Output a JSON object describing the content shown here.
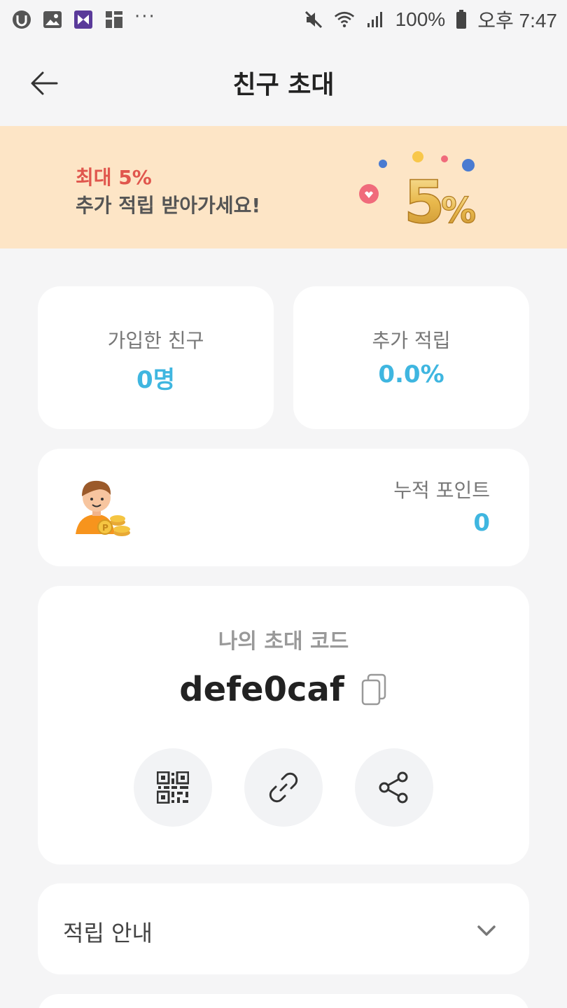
{
  "status_bar": {
    "battery": "100%",
    "time": "오후 7:47",
    "icons": [
      "u-plus-app-icon",
      "gallery-icon",
      "media-app-icon",
      "app-grid-icon",
      "more-dots-icon",
      "mute-icon",
      "wifi-icon",
      "signal-icon",
      "battery-icon"
    ]
  },
  "header": {
    "title": "친구 초대"
  },
  "banner": {
    "line1": "최대 5%",
    "line2": "추가 적립 받아가세요!"
  },
  "stats": {
    "joined_label": "가입한 친구",
    "joined_value": "0명",
    "bonus_label": "추가 적립",
    "bonus_value": "0.0%"
  },
  "points": {
    "label": "누적 포인트",
    "value": "0"
  },
  "invite": {
    "label": "나의 초대 코드",
    "code": "defe0caf"
  },
  "guide": {
    "title": "적립 안내"
  },
  "colors": {
    "accent": "#3fb6e0",
    "banner_bg": "#fde5c6",
    "banner_red": "#e0564d",
    "page_bg": "#f5f5f6"
  }
}
